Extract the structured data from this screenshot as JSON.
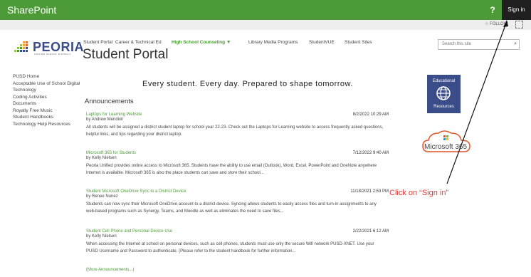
{
  "header": {
    "brand": "SharePoint",
    "help_label": "?",
    "signin_label": "Sign in",
    "follow_label": "FOLLOW"
  },
  "logo": {
    "name": "PEORIA",
    "subtitle": "UNIFIED SCHOOL DISTRICT"
  },
  "nav": {
    "items": [
      {
        "label": "Student Portal"
      },
      {
        "label": "Career & Technical Ed"
      },
      {
        "label": "High School Counseling ▼"
      },
      {
        "label": "Library Media Programs"
      },
      {
        "label": "StudentVUE"
      },
      {
        "label": "Student Sites"
      }
    ]
  },
  "site": {
    "title": "Student Portal"
  },
  "search": {
    "placeholder": "Search this site"
  },
  "quicklaunch": {
    "items": [
      {
        "label": "PUSD Home"
      },
      {
        "label": "Acceptable Use of School Digital Technology"
      },
      {
        "label": "Coding Activities"
      },
      {
        "label": "Documents"
      },
      {
        "label": "Royalty Free Music"
      },
      {
        "label": "Student Handbooks"
      },
      {
        "label": "Technology Help Resources"
      }
    ]
  },
  "main": {
    "tagline": "Every student. Every day. Prepared to shape tomorrow.",
    "announcements_title": "Announcements",
    "announcements": [
      {
        "title": "Laptops for Learning Website",
        "author": "by Andrew Mendivil",
        "date": "8/2/2022 10:29 AM",
        "body": "All students will be assigned a district student laptop for school year 22-23. Check out the Laptops for Learning website to access frequently asked questions, helpful links, and tips regarding your district laptop."
      },
      {
        "title": "Microsoft 365 for Students",
        "author": "by Kelly Nielsen",
        "date": "7/12/2022 9:40 AM",
        "body": "Peoria Unified provides online access to Microsoft 365. Students have the ability to use email (Outlook), Word, Excel, PowerPoint and OneNote anywhere Internet is available. Microsoft 365 is also the place students can save and store their school..."
      },
      {
        "title": "Student Microsoft OneDrive Sync to a District Device",
        "author": "by Renee Nunez",
        "date": "11/18/2021 2:53 PM",
        "body": "Students can now sync their Microsoft OneDrive account to a district device. Syncing allows students to easily access files and turn-in assignments to any web-based programs such as Synergy, Teams, and Moodle as well as eliminates the need to save files..."
      },
      {
        "title": "Student Cell Phone and Personal Device Use",
        "author": "by Kelly Nielsen",
        "date": "2/22/2021 6:12 AM",
        "body": "When accessing the Internet at school on personal devices, such as cell phones, students must use only the secure Wifi network PUSD-XNET. Use your PUSD Username and Password to authenticate. (Please refer to the student handbook for further information..."
      }
    ],
    "more_label": "(More Announcements...)"
  },
  "sidebar_right": {
    "edu_line1": "Educational",
    "edu_line2": "Resources",
    "ms365_label": "Microsoft 365"
  },
  "annotation": {
    "text": "Click on “Sign in”"
  },
  "colors": {
    "brand_green": "#4c9a38",
    "signin_bg": "#1f1f1f",
    "tile_blue": "#3b4d89",
    "annotation_red": "#e53935"
  }
}
